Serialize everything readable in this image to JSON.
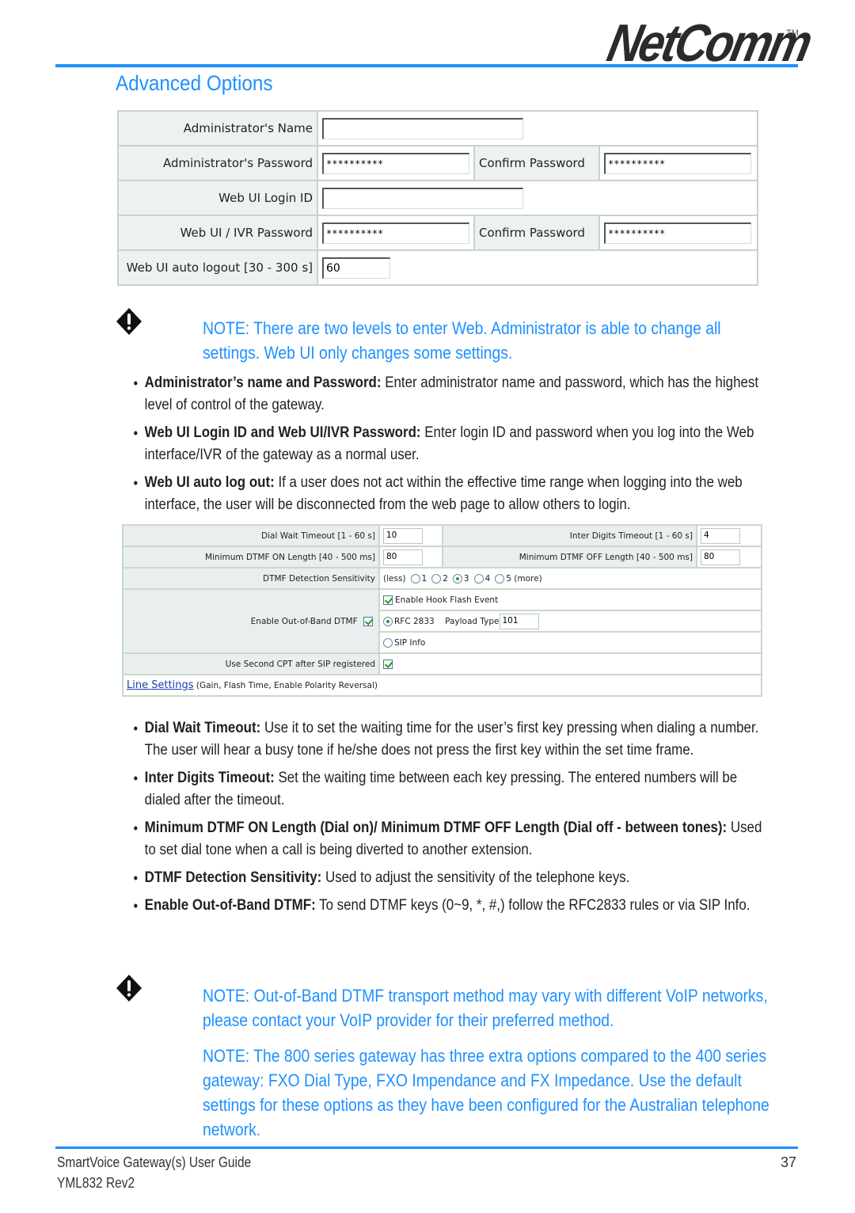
{
  "header": {
    "brand": "NetComm",
    "brand_tm": "TM",
    "page_title": "Advanced Options"
  },
  "admin_form": {
    "admin_name": {
      "label": "Administrator's Name",
      "value": ""
    },
    "admin_password": {
      "label": "Administrator's Password",
      "value": "**********",
      "confirm_label": "Confirm Password",
      "confirm_value": "**********"
    },
    "web_login_id": {
      "label": "Web UI Login ID",
      "value": ""
    },
    "web_password": {
      "label": "Web UI / IVR Password",
      "value": "**********",
      "confirm_label": "Confirm Password",
      "confirm_value": "**********"
    },
    "auto_logout": {
      "label": "Web UI auto logout [30 - 300 s]",
      "value": "60"
    }
  },
  "note1": {
    "icon": "warning-diamond-icon",
    "text": "NOTE: There are two levels to enter Web. Administrator is able to change all settings. Web UI only changes some settings."
  },
  "bullets1": [
    {
      "term": "Administrator’s name and Password:",
      "text": " Enter administrator name and password, which has the highest level of control of the gateway."
    },
    {
      "term": "Web UI Login ID and Web UI/IVR Password:",
      "text": " Enter login ID and password when you log into the Web interface/IVR of the gateway as a normal user."
    },
    {
      "term": "Web UI auto log out:",
      "text": " If a user does not act within the effective time range when logging into the web interface, the user will be disconnected from the web page to allow others to login."
    }
  ],
  "dial_form": {
    "dial_wait": {
      "label": "Dial Wait Timeout [1 - 60 s]",
      "value": "10"
    },
    "inter_digits": {
      "label": "Inter Digits Timeout [1 - 60 s]",
      "value": "4"
    },
    "dtmf_on": {
      "label": "Minimum DTMF ON Length [40 - 500 ms]",
      "value": "80"
    },
    "dtmf_off": {
      "label": "Minimum DTMF OFF Length [40 - 500 ms]",
      "value": "80"
    },
    "sensitivity": {
      "label": "DTMF Detection Sensitivity",
      "prefix": "(less)",
      "options": [
        "1",
        "2",
        "3",
        "4",
        "5 (more)"
      ],
      "selected": "3"
    },
    "out_of_band": {
      "label": "Enable Out-of-Band DTMF",
      "checked": true,
      "hook_flash_label": "Enable Hook Flash Event",
      "hook_flash_checked": true,
      "rfc_label": "RFC 2833",
      "rfc_selected": true,
      "payload_label": "Payload Type",
      "payload_value": "101",
      "sip_info_label": "SIP Info",
      "sip_info_selected": false
    },
    "second_cpt": {
      "label": "Use Second CPT after SIP registered",
      "checked": true
    },
    "line_settings": {
      "link": "Line Settings",
      "desc": " (Gain, Flash Time, Enable Polarity Reversal)"
    }
  },
  "bullets2": [
    {
      "term": "Dial Wait Timeout:",
      "text": " Use it to set the waiting time for the user’s first key pressing when dialing a number. The user will hear a busy tone if he/she does not press the first key within the set time frame."
    },
    {
      "term": "Inter Digits Timeout:",
      "text": " Set the waiting time between each key pressing. The entered numbers will be dialed after the timeout."
    },
    {
      "term": "Minimum DTMF ON Length (Dial on)/ Minimum DTMF OFF Length (Dial off - between tones):",
      "text": " Used to set dial tone when a call is being diverted to another extension."
    },
    {
      "term": "DTMF Detection Sensitivity:",
      "text": " Used to adjust the sensitivity of the telephone keys."
    },
    {
      "term": "Enable Out-of-Band DTMF:",
      "text": " To send DTMF keys (0~9, *, #,) follow the RFC2833 rules or via SIP Info."
    }
  ],
  "note2": {
    "icon": "warning-diamond-icon",
    "text": "NOTE: Out-of-Band DTMF transport method may vary with different VoIP networks, please contact your VoIP provider for their preferred method."
  },
  "note3": {
    "text": "NOTE: The 800 series gateway has three extra options compared to the 400 series gateway:  FXO Dial Type, FXO Impendance and FX Impedance.  Use the default settings for these options as they have been configured for the Australian telephone network."
  },
  "footer": {
    "guide_title": "SmartVoice Gateway(s) User Guide",
    "doc_code": "YML832 Rev2",
    "page_number": "37"
  },
  "colors": {
    "accent": "#1e90ff",
    "text": "#231f20",
    "label_bg": "#eef1f1",
    "table_border": "#c7d4c7"
  }
}
